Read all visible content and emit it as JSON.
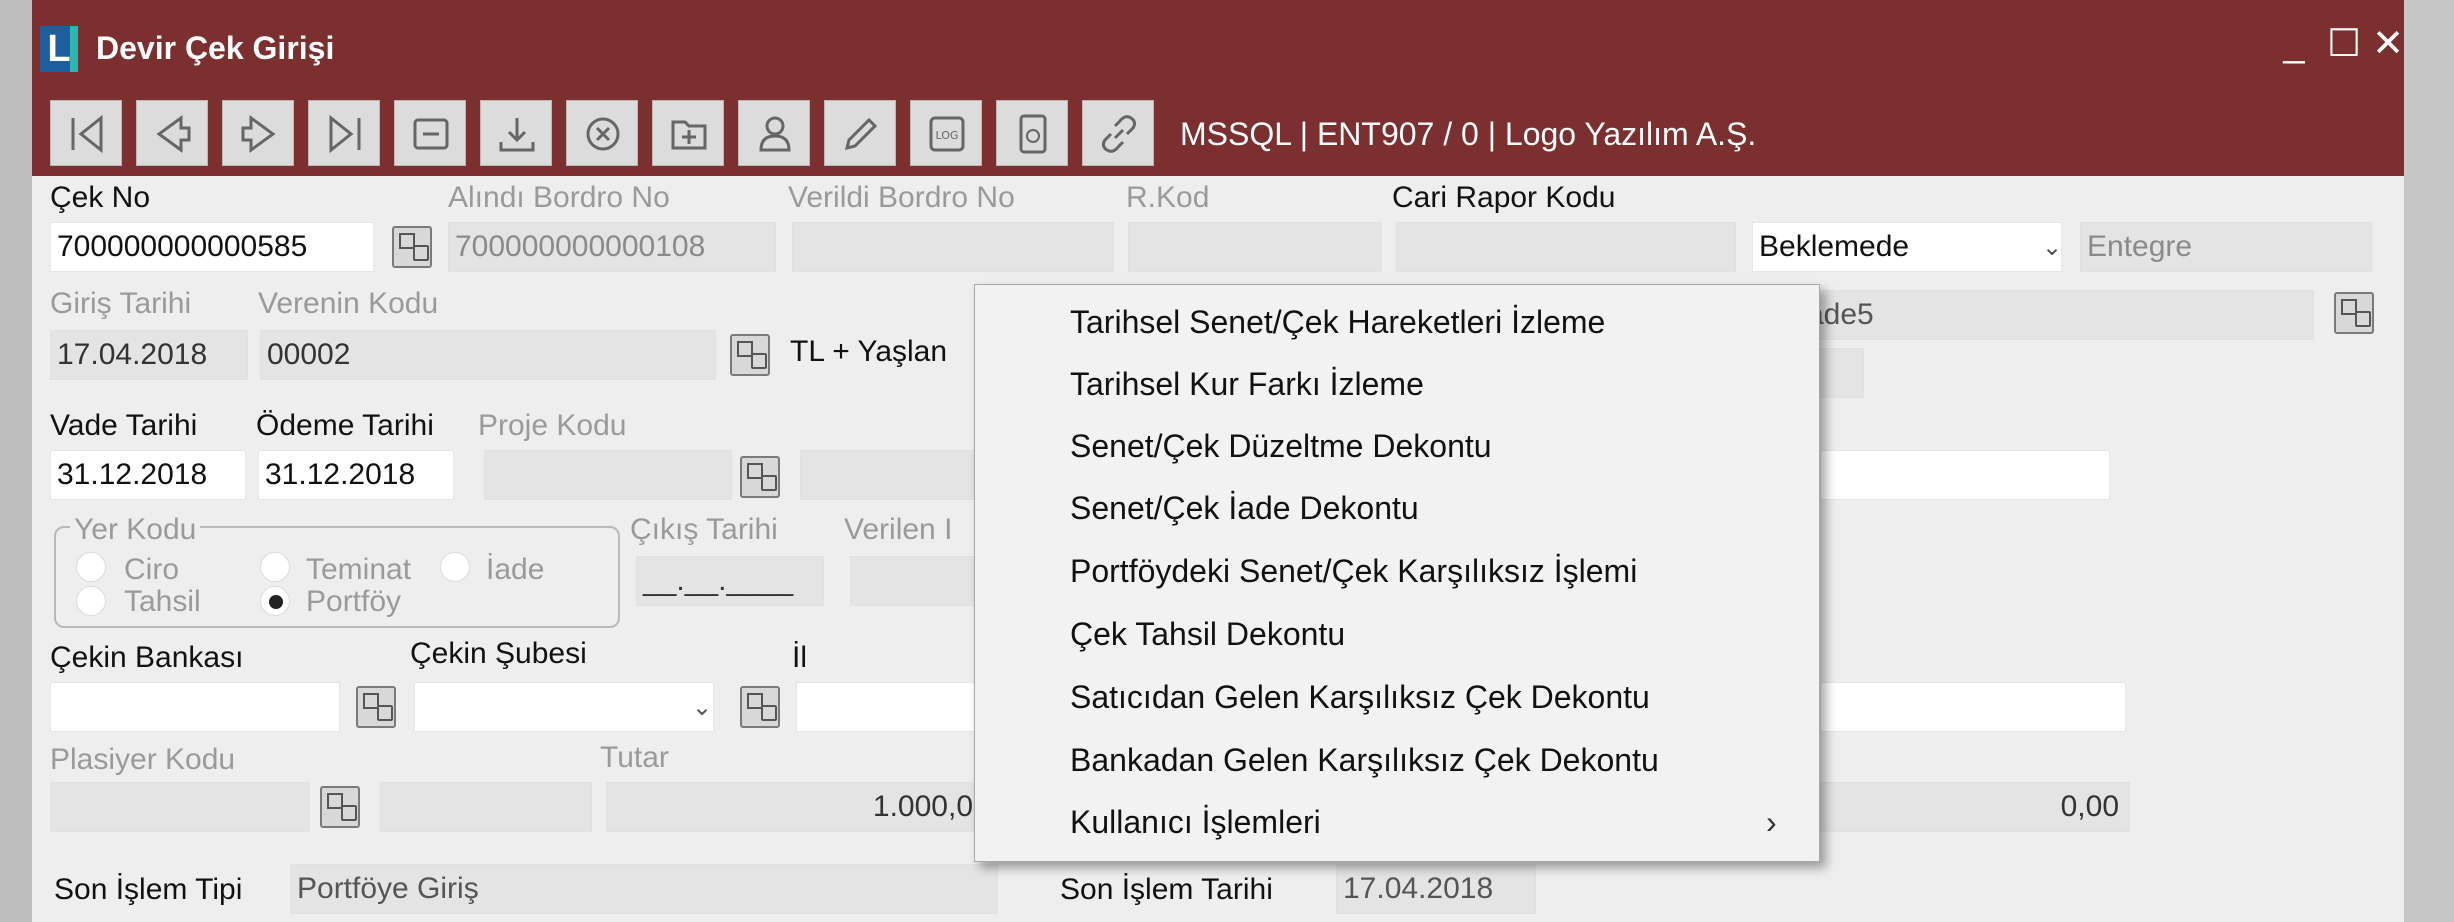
{
  "window": {
    "title": "Devir Çek Girişi",
    "logo_letter": "L",
    "buttons": [
      "_",
      "☐",
      "✕"
    ]
  },
  "toolbar": {
    "icons": [
      "first-record-icon",
      "prev-record-icon",
      "next-record-icon",
      "last-record-icon",
      "list-icon",
      "download-icon",
      "cancel-icon",
      "add-folder-icon",
      "user-icon",
      "edit-icon",
      "log-icon",
      "document-icon",
      "link-icon"
    ],
    "connection_info": "MSSQL | ENT907 / 0 | Logo Yazılım A.Ş."
  },
  "form": {
    "cek_no": {
      "label": "Çek No",
      "value": "700000000000585"
    },
    "alindi_bordro_no": {
      "label": "Alındı Bordro No",
      "value": "700000000000108"
    },
    "verildi_bordro_no": {
      "label": "Verildi Bordro No",
      "value": ""
    },
    "r_kod": {
      "label": "R.Kod",
      "value": ""
    },
    "cari_rapor_kodu": {
      "label": "Cari Rapor Kodu",
      "value": ""
    },
    "status": {
      "value": "Beklemede"
    },
    "entegre": {
      "value": "Entegre"
    },
    "giris_tarihi": {
      "label": "Giriş Tarihi",
      "value": "17.04.2018"
    },
    "verenin_kodu": {
      "label": "Verenin Kodu",
      "value": "00002"
    },
    "verenin_unvani": {
      "value": "TL + Yaşlan"
    },
    "hidden_field_right": {
      "value": "ade5"
    },
    "vade_tarihi": {
      "label": "Vade Tarihi",
      "value": "31.12.2018"
    },
    "odeme_tarihi": {
      "label": "Ödeme Tarihi",
      "value": "31.12.2018"
    },
    "proje_kodu": {
      "label": "Proje Kodu",
      "value": ""
    },
    "yer_kodu": {
      "label": "Yer Kodu",
      "options": [
        {
          "label": "Ciro",
          "selected": false
        },
        {
          "label": "Teminat",
          "selected": false
        },
        {
          "label": "İade",
          "selected": false
        },
        {
          "label": "Tahsil",
          "selected": false
        },
        {
          "label": "Portföy",
          "selected": true
        }
      ]
    },
    "cikis_tarihi": {
      "label": "Çıkış Tarihi",
      "value": "__.__.____"
    },
    "verilen": {
      "label": "Verilen I",
      "value": ""
    },
    "cekin_bankasi": {
      "label": "Çekin Bankası",
      "value": ""
    },
    "cekin_subesi": {
      "label": "Çekin Şubesi",
      "value": ""
    },
    "il": {
      "label": "İl",
      "value": ""
    },
    "plasiyer_kodu": {
      "label": "Plasiyer Kodu",
      "value": ""
    },
    "tutar": {
      "label": "Tutar",
      "value": "1.000,0"
    },
    "right_amount": {
      "value": "0,00"
    },
    "son_islem_tipi": {
      "label": "Son İşlem Tipi",
      "value": "Portföye Giriş"
    },
    "son_islem_tarihi": {
      "label": "Son İşlem Tarihi",
      "value": "17.04.2018"
    }
  },
  "context_menu": {
    "items": [
      {
        "label": "Tarihsel Senet/Çek Hareketleri İzleme"
      },
      {
        "label": "Tarihsel Kur Farkı İzleme"
      },
      {
        "label": "Senet/Çek Düzeltme Dekontu"
      },
      {
        "label": "Senet/Çek İade Dekontu"
      },
      {
        "label": "Portföydeki Senet/Çek Karşılıksız İşlemi"
      },
      {
        "label": "Çek Tahsil Dekontu"
      },
      {
        "label": "Satıcıdan Gelen Karşılıksız Çek Dekontu"
      },
      {
        "label": "Bankadan Gelen Karşılıksız Çek Dekontu"
      },
      {
        "label": "Kullanıcı İşlemleri",
        "arrow": "›"
      }
    ]
  }
}
